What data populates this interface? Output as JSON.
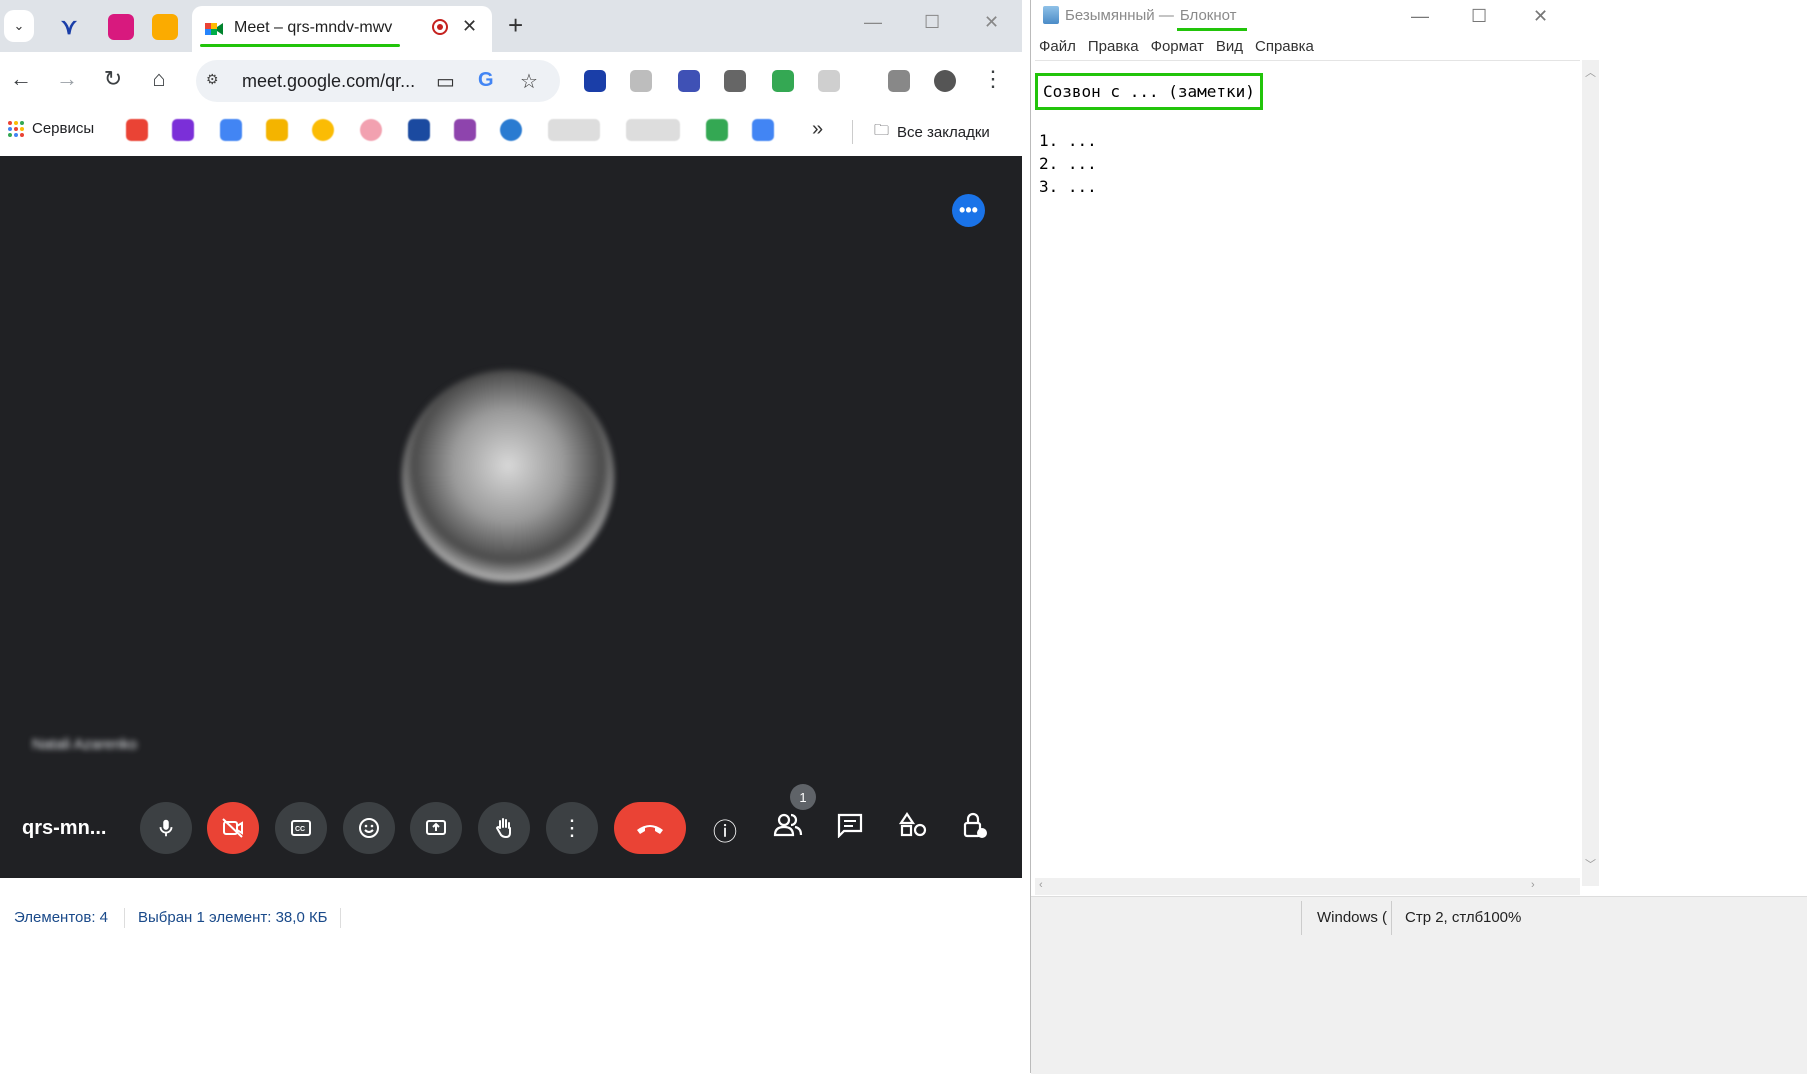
{
  "chrome": {
    "tab_title": "Meet – qrs-mndv-mwv",
    "url": "meet.google.com/qr...",
    "new_tab": "+",
    "close_tab": "✕"
  },
  "bookmarks": {
    "services": "Сервисы",
    "all_bookmarks": "Все закладки",
    "more": "»"
  },
  "meet": {
    "participant_name": "Natali Azarenko",
    "meeting_code": "qrs-mn...",
    "participants_count": "1",
    "accent": "#1a73e8",
    "danger": "#ea4335"
  },
  "explorer": {
    "items_count": "Элементов: 4",
    "selection": "Выбран 1 элемент: 38,0 КБ"
  },
  "notepad": {
    "title_file": "Безымянный — ",
    "title_app": "Блокнот",
    "menu": [
      "Файл",
      "Правка",
      "Формат",
      "Вид",
      "Справка"
    ],
    "heading": "Созвон с ... (заметки)",
    "lines": [
      "1. ...",
      "2. ...",
      "3. ..."
    ],
    "status_eol": "Windows (",
    "status_pos": "Стр 2, стлб",
    "status_zoom": "100%"
  }
}
